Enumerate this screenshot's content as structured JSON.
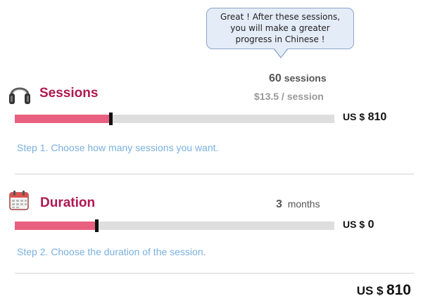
{
  "bubble": {
    "lines": [
      "Great !  After these sessions,",
      "you will make a greater",
      "progress in Chinese !"
    ]
  },
  "sessions": {
    "title": "Sessions",
    "icon": "headphones-icon",
    "count": "60",
    "count_unit": "sessions",
    "rate": "$13.5 / session",
    "slider_fraction": 0.3,
    "price_currency": "US $",
    "price_amount": "810",
    "step": "Step 1. Choose how many sessions you want."
  },
  "duration": {
    "title": "Duration",
    "icon": "calendar-icon",
    "count": "3",
    "count_unit": "months",
    "slider_fraction": 0.255,
    "price_currency": "US $",
    "price_amount": "0",
    "step": "Step 2. Choose the duration of the session."
  },
  "total": {
    "currency": "US $",
    "amount": "810"
  },
  "colors": {
    "accent": "#b0194e",
    "fill": "#e8607f",
    "track": "#dedede",
    "step_text": "#7ab0df"
  }
}
